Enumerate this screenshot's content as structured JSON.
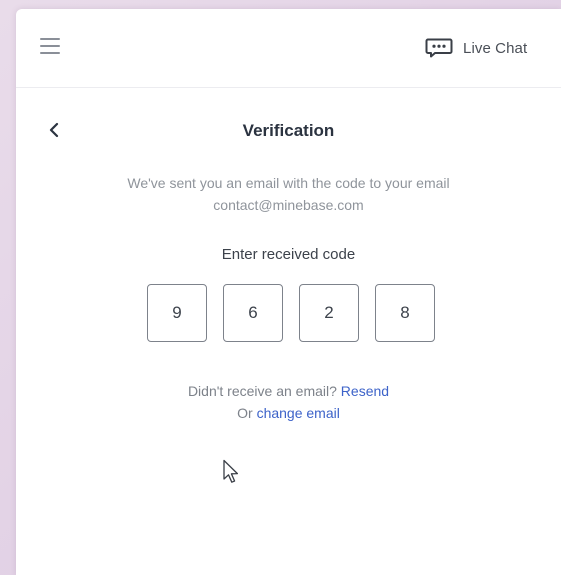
{
  "header": {
    "menu_icon": "hamburger-menu-icon",
    "live_chat_icon": "chat-bubble-dots-icon",
    "live_chat_label": "Live Chat"
  },
  "verification": {
    "back_icon": "chevron-left-icon",
    "title": "Verification",
    "description_line1": "We've sent you an email with the code to your email",
    "description_line2": "contact@minebase.com",
    "code_label": "Enter received code",
    "code_digits": [
      "9",
      "6",
      "2",
      "8"
    ],
    "resend_prompt": "Didn't receive an email?",
    "resend_link": "Resend",
    "change_prefix": "Or",
    "change_link": "change email"
  },
  "colors": {
    "link": "#3d63c9",
    "title": "#2b3340",
    "muted_text": "#8f949b",
    "code_border": "#7d828b"
  }
}
